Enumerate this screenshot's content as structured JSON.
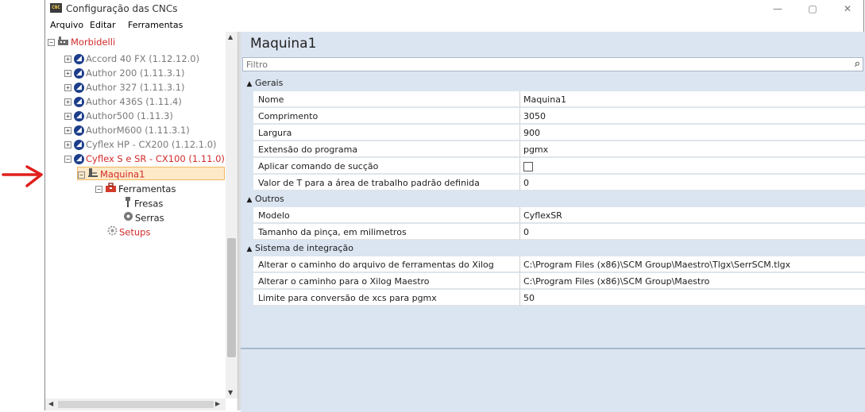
{
  "window": {
    "title": "Configuração das CNCs",
    "app_icon": "CNC",
    "controls": [
      "—",
      "▢",
      "✕"
    ]
  },
  "menu": [
    "Arquivo",
    "Editar",
    "Ferramentas"
  ],
  "tree": {
    "root": "Morbidelli",
    "machines": [
      {
        "label": "Accord 40 FX (1.12.12.0)"
      },
      {
        "label": "Author 200 (1.11.3.1)"
      },
      {
        "label": "Author 327 (1.11.3.1)"
      },
      {
        "label": "Author 436S (1.11.4)"
      },
      {
        "label": "Author500 (1.11.3)"
      },
      {
        "label": "AuthorM600 (1.11.3.1)"
      },
      {
        "label": "Cyflex HP - CX200 (1.12.1.0)"
      },
      {
        "label": "Cyflex S e SR - CX100 (1.11.0)"
      }
    ],
    "selected": "Maquina1",
    "tools": "Ferramentas",
    "fresas": "Fresas",
    "serras": "Serras",
    "setups": "Setups"
  },
  "panel": {
    "title": "Maquina1",
    "filter_placeholder": "Filtro",
    "categories": [
      {
        "name": "Gerais",
        "rows": [
          {
            "name": "Nome",
            "value": "Maquina1"
          },
          {
            "name": "Comprimento",
            "value": "3050"
          },
          {
            "name": "Largura",
            "value": "900"
          },
          {
            "name": "Extensão do programa",
            "value": "pgmx"
          },
          {
            "name": "Aplicar comando de sucção",
            "value": ""
          },
          {
            "name": "Valor de T para a área de trabalho padrão definida",
            "value": "0"
          }
        ]
      },
      {
        "name": "Outros",
        "rows": [
          {
            "name": "Modelo",
            "value": "CyflexSR"
          },
          {
            "name": "Tamanho da pinça, em milimetros",
            "value": "0"
          }
        ]
      },
      {
        "name": "Sistema de integração",
        "rows": [
          {
            "name": "Alterar o caminho do arquivo de ferramentas do Xilog Maestro",
            "value": "C:\\Program Files (x86)\\SCM Group\\Maestro\\Tlgx\\SerrSCM.tlgx"
          },
          {
            "name": "Alterar o caminho para o Xilog Maestro",
            "value": "C:\\Program Files (x86)\\SCM Group\\Maestro"
          },
          {
            "name": "Limite para conversão de xcs para pgmx",
            "value": "50"
          }
        ]
      }
    ]
  },
  "colors": {
    "accent_red": "#d22b2b",
    "arrow_red": "#e0201e",
    "panel_bg": "#dbe5f1",
    "selection": "#fde9c8"
  }
}
